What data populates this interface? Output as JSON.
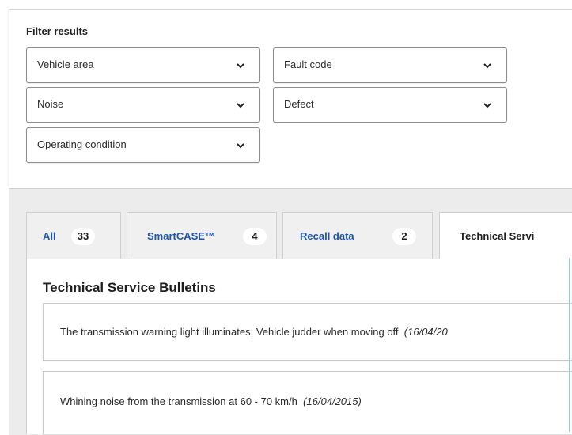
{
  "filter": {
    "title": "Filter results",
    "selects": [
      {
        "label": "Vehicle area"
      },
      {
        "label": "Fault code"
      },
      {
        "label": "Noise"
      },
      {
        "label": "Defect"
      },
      {
        "label": "Operating condition"
      }
    ]
  },
  "tabs": [
    {
      "label": "All",
      "count": "33",
      "active": false
    },
    {
      "label": "SmartCASE™",
      "count": "4",
      "active": false
    },
    {
      "label": "Recall data",
      "count": "2",
      "active": false
    },
    {
      "label": "Technical Servi",
      "active": true
    }
  ],
  "section": {
    "heading": "Technical Service Bulletins",
    "bulletins": [
      {
        "text": "The transmission warning light illuminates; Vehicle judder when moving off",
        "date": "(16/04/20"
      },
      {
        "text": "Whining noise from the transmission at 60 - 70 km/h",
        "date": "(16/04/2015)"
      }
    ]
  },
  "colors": {
    "tab_link": "#1f55a8",
    "panel_gray": "#ececec",
    "edge_accent": "#9cc6da"
  }
}
